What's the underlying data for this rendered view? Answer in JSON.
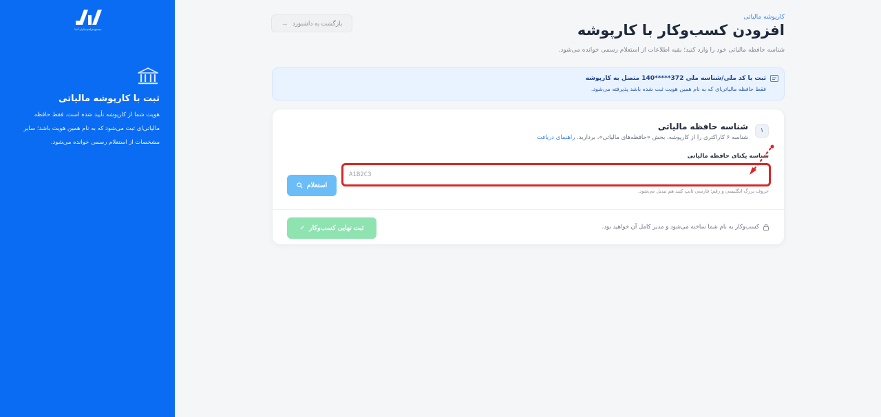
{
  "sidebar": {
    "logo_subtext": "مجتمع فراهم‌سازان آسا",
    "title": "ثبت با کارپوشه مالیاتی",
    "description": "هویت شما از کارپوشه تأیید شده است. فقط حافظه مالیاتی‌ای ثبت می‌شود که به نام همین هویت باشد؛ سایر مشخصات از استعلام رسمی خوانده می‌شود."
  },
  "header": {
    "breadcrumb": "کارپوشه مالیاتی",
    "title": "افزودن کسب‌وکار با کارپوشه",
    "subtitle": "شناسه حافظه مالیاتی خود را وارد کنید؛ بقیه اطلاعات از استعلام رسمی خوانده می‌شود.",
    "back_label": "بازگشت به داشبورد",
    "back_icon": "arrow-right-icon"
  },
  "info": {
    "title": "ثبت با کد ملی/شناسه ملی 372*****140 متصل به کارپوشه",
    "text": "فقط حافظه مالیاتی‌ای که به نام همین هویت ثبت شده باشد پذیرفته می‌شود."
  },
  "step": {
    "number": "۱",
    "title": "شناسه حافظه مالیاتی",
    "description": "شناسه ۶ کاراکتری را از کارپوشه، بخش «حافظه‌های مالیاتی»، بردارید.",
    "link": "راهنمای دریافت",
    "field_label": "شناسه یکتای حافظه مالیاتی",
    "field_placeholder": "A1B2C3",
    "field_hint": "حروف بزرگ انگلیسی و رقم؛ فارسی تایپ کنید هم تبدیل می‌شود.",
    "inquiry_button": "استعلام"
  },
  "footer": {
    "note": "کسب‌وکار به نام شما ساخته می‌شود و مدیر کامل آن خواهید بود.",
    "submit_button": "ثبت نهایی کسب‌وکار"
  },
  "colors": {
    "sidebar_bg": "#0a6cf2",
    "accent": "#3b82f6",
    "highlight_border": "#d92626",
    "inquiry_button": "#6bbdf7",
    "submit_button": "#8ee3b0"
  }
}
